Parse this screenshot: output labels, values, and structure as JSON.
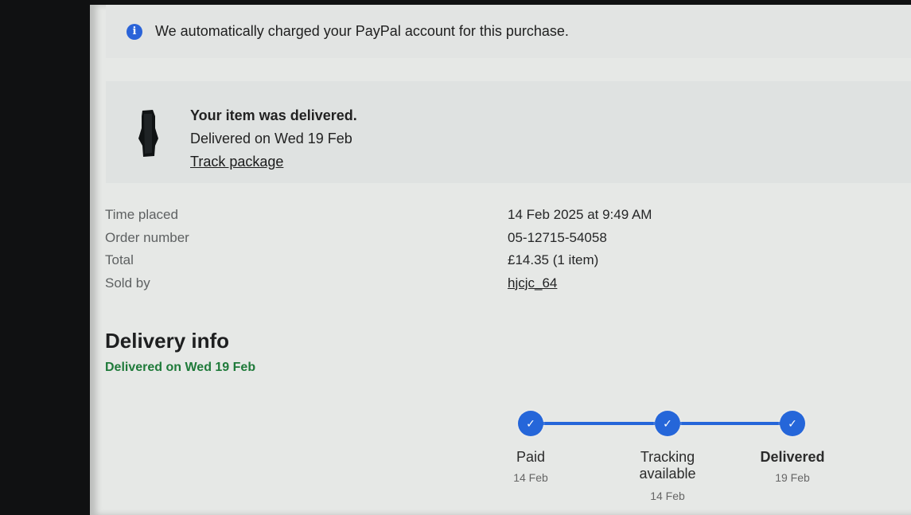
{
  "banner": {
    "icon": "info-icon",
    "message": "We automatically charged your PayPal account for this purchase."
  },
  "delivery_card": {
    "title": "Your item was delivered.",
    "delivered_on": "Delivered on Wed 19 Feb",
    "track_label": "Track package"
  },
  "order": {
    "rows": [
      {
        "label": "Time placed",
        "value": "14 Feb 2025 at 9:49 AM"
      },
      {
        "label": "Order number",
        "value": "05-12715-54058"
      },
      {
        "label": "Total",
        "value": "£14.35 (1 item)"
      },
      {
        "label": "Sold by",
        "value": "hjcjc_64"
      }
    ]
  },
  "delivery_info": {
    "heading": "Delivery info",
    "status": "Delivered on Wed 19 Feb"
  },
  "timeline": {
    "steps": [
      {
        "label": "Paid",
        "date": "14 Feb",
        "current": false
      },
      {
        "label": "Tracking available",
        "date": "14 Feb",
        "current": false
      },
      {
        "label": "Delivered",
        "date": "19 Feb",
        "current": true
      }
    ],
    "accent": "#2566d9"
  },
  "colors": {
    "info": "#2a63d8",
    "success": "#1f7a3a"
  }
}
